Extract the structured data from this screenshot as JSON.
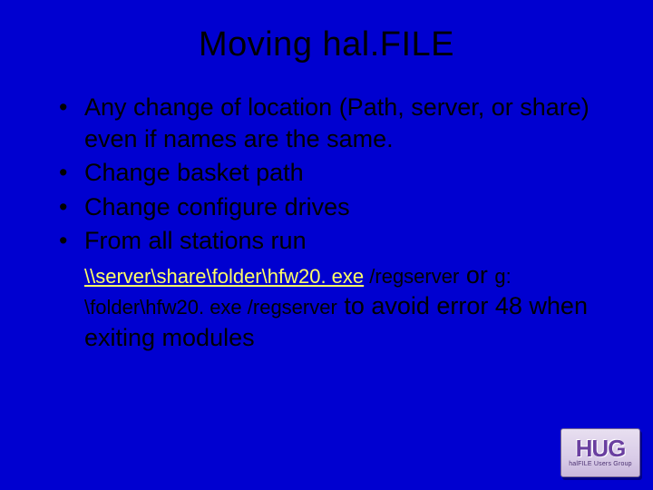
{
  "title": "Moving hal.FILE",
  "bullets": [
    "Any change of location (Path, server, or share) even if names are the same.",
    "Change basket path",
    "Change configure drives",
    "From all stations run"
  ],
  "sub": {
    "link": "\\\\server\\share\\folder\\hfw20. exe",
    "cmd1_tail": " /regserver",
    "or": " or ",
    "cmd2": "g: \\folder\\hfw20. exe /regserver",
    "tail": " to avoid error 48 when exiting modules"
  },
  "logo": {
    "big": "HUG",
    "small": "halFILE Users Group"
  }
}
